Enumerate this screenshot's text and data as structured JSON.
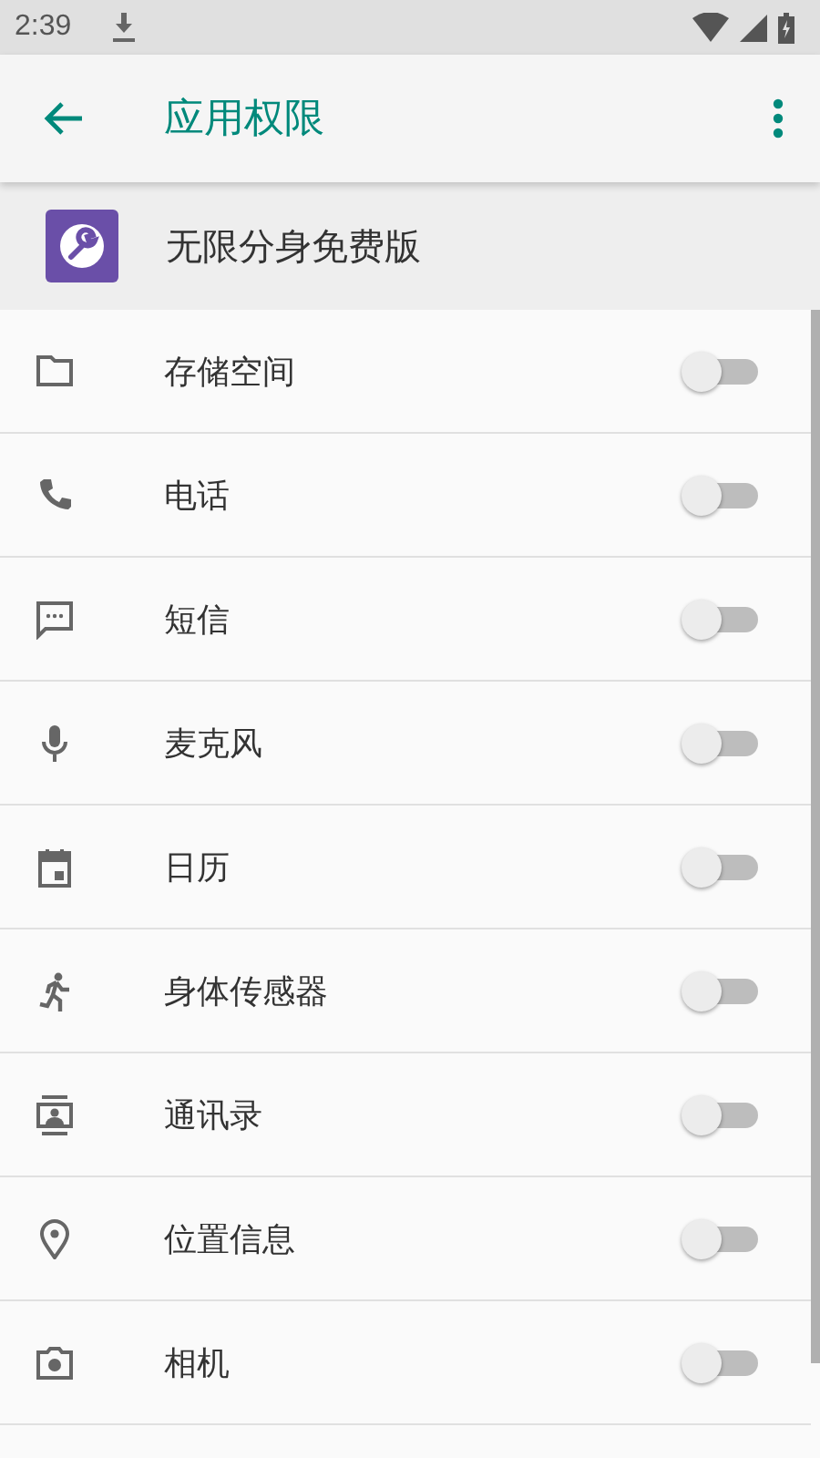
{
  "status_bar": {
    "time": "2:39"
  },
  "app_bar": {
    "title": "应用权限"
  },
  "app": {
    "name": "无限分身免费版"
  },
  "permissions": [
    {
      "kind": "storage",
      "label": "存储空间",
      "on": false
    },
    {
      "kind": "phone",
      "label": "电话",
      "on": false
    },
    {
      "kind": "sms",
      "label": "短信",
      "on": false
    },
    {
      "kind": "microphone",
      "label": "麦克风",
      "on": false
    },
    {
      "kind": "calendar",
      "label": "日历",
      "on": false
    },
    {
      "kind": "sensors",
      "label": "身体传感器",
      "on": false
    },
    {
      "kind": "contacts",
      "label": "通讯录",
      "on": false
    },
    {
      "kind": "location",
      "label": "位置信息",
      "on": false
    },
    {
      "kind": "camera",
      "label": "相机",
      "on": false
    }
  ]
}
